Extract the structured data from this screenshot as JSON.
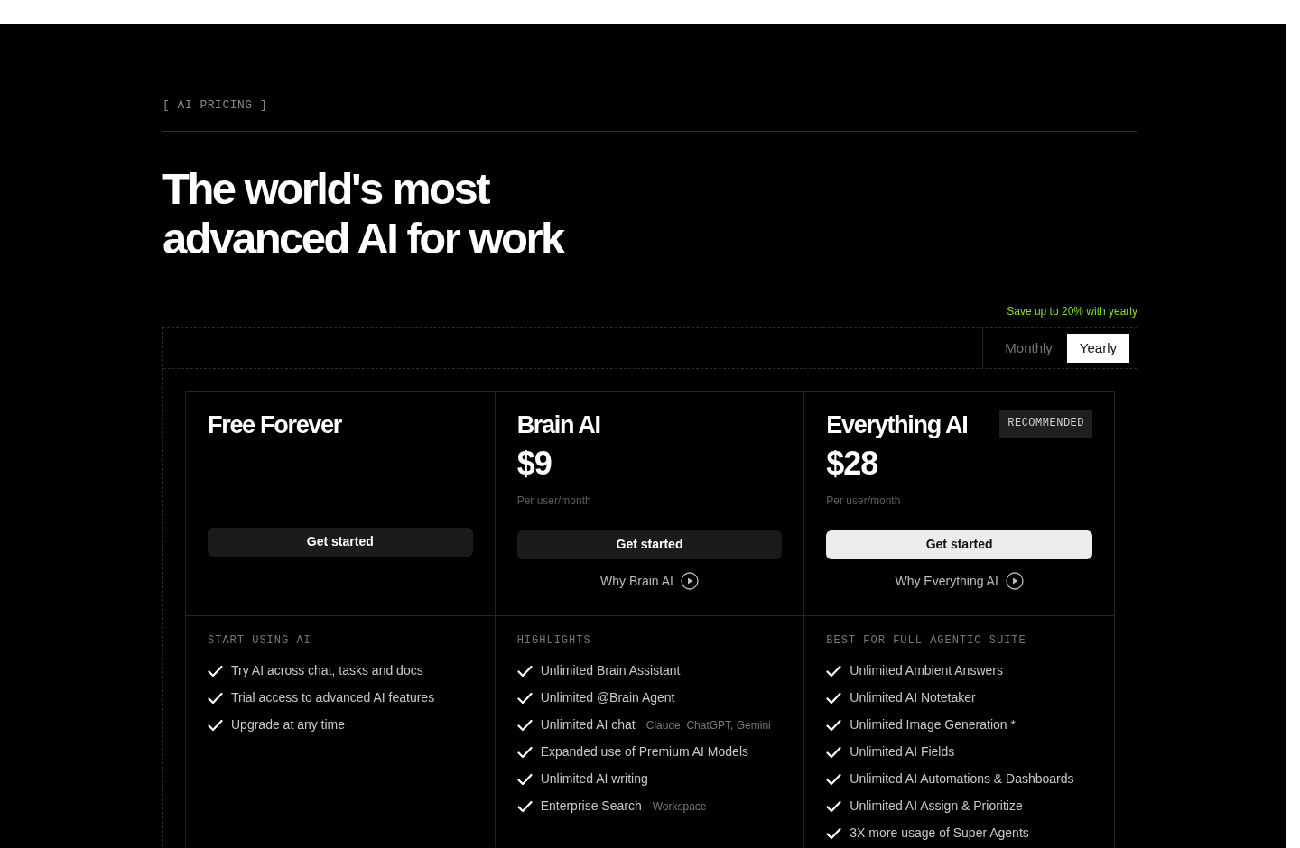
{
  "eyebrow": "[ AI PRICING ]",
  "headline": [
    "The world's most",
    "advanced AI for work"
  ],
  "billing": {
    "promo": "Save up to 20% with yearly",
    "options": [
      {
        "label": "Monthly",
        "selected": false
      },
      {
        "label": "Yearly",
        "selected": true
      }
    ]
  },
  "plans": [
    {
      "name": "Free Forever",
      "featured": false,
      "cta": "Get started",
      "section_label": "START USING AI",
      "features": [
        {
          "text": "Try AI across chat, tasks and docs"
        },
        {
          "text": "Trial access to advanced AI features"
        },
        {
          "text": "Upgrade at any time"
        }
      ]
    },
    {
      "name": "Brain AI",
      "price": "$9",
      "price_note": "Per user/month",
      "featured": false,
      "cta": "Get started",
      "why_link": "Why Brain AI",
      "section_label": "HIGHLIGHTS",
      "features": [
        {
          "text": "Unlimited Brain Assistant"
        },
        {
          "text": "Unlimited @Brain Agent"
        },
        {
          "text": "Unlimited AI chat",
          "note": "Claude, ChatGPT, Gemini"
        },
        {
          "text": "Expanded use of Premium AI Models"
        },
        {
          "text": "Unlimited AI writing"
        },
        {
          "text": "Enterprise Search",
          "note": "Workspace"
        }
      ]
    },
    {
      "name": "Everything AI",
      "badge": "RECOMMENDED",
      "price": "$28",
      "price_note": "Per user/month",
      "featured": true,
      "cta": "Get started",
      "why_link": "Why Everything AI",
      "section_label": "BEST FOR FULL AGENTIC SUITE",
      "features": [
        {
          "text": "Unlimited Ambient Answers"
        },
        {
          "text": "Unlimited AI Notetaker"
        },
        {
          "text": "Unlimited Image Generation *"
        },
        {
          "text": "Unlimited AI Fields"
        },
        {
          "text": "Unlimited AI Automations & Dashboards"
        },
        {
          "text": "Unlimited AI Assign & Prioritize"
        },
        {
          "text": "3X more usage of Super Agents"
        }
      ]
    }
  ]
}
